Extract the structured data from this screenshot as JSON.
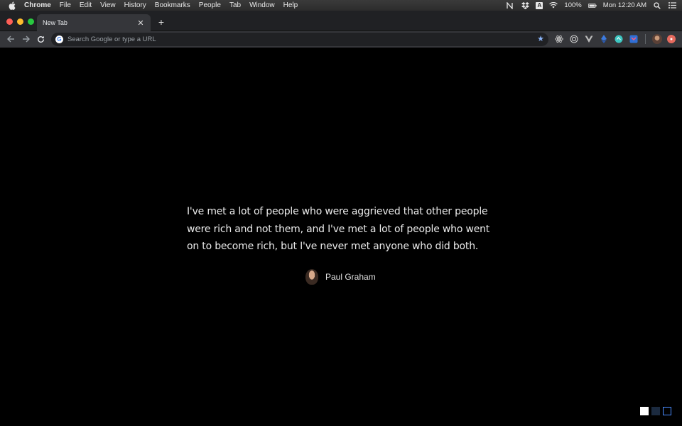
{
  "menubar": {
    "app_name": "Chrome",
    "items": [
      "File",
      "Edit",
      "View",
      "History",
      "Bookmarks",
      "People",
      "Tab",
      "Window",
      "Help"
    ],
    "status": {
      "battery": "100%",
      "clock": "Mon 12:20 AM"
    }
  },
  "tabs": [
    {
      "title": "New Tab",
      "active": true
    }
  ],
  "toolbar": {
    "omnibox_placeholder": "Search Google or type a URL"
  },
  "quote": {
    "text": "I've met a lot of people who were aggrieved that other people were rich and not them, and I've met a lot of people who went on to become rich, but I've never met anyone who did both.",
    "author": "Paul Graham"
  },
  "theme_swatches": [
    "#ffffff",
    "#1b2a3f",
    "#4a8cff"
  ]
}
